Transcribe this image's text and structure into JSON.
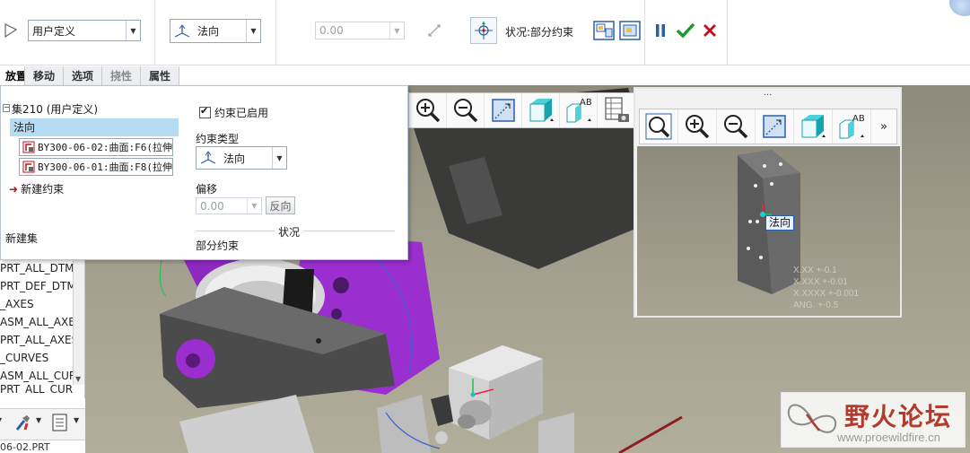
{
  "dashboard": {
    "constraint_set": "用户定义",
    "constraint_type": "法向",
    "offset_value": "0.00",
    "status_text": "状况:部分约束"
  },
  "tabs": [
    {
      "label": "放置"
    },
    {
      "label": "移动"
    },
    {
      "label": "选项"
    },
    {
      "label": "挠性"
    },
    {
      "label": "属性"
    }
  ],
  "placement_panel": {
    "set_header": "集210 (用户定义)",
    "selected_constraint": "法向",
    "references": [
      "BY300-06-02:曲面:F6(拉伸",
      "BY300-06-01:曲面:F8(拉伸"
    ],
    "new_constraint": "新建约束",
    "new_set": "新建集",
    "enabled_label": "约束已启用",
    "type_label": "约束类型",
    "type_value": "法向",
    "offset_label": "偏移",
    "offset_value": "0.00",
    "flip_button": "反向",
    "status_label": "状况",
    "status_value": "部分约束"
  },
  "model_tree": {
    "items": [
      "PRT_ALL_DTM_",
      "PRT_DEF_DTM_",
      "_AXES",
      "ASM_ALL_AXES",
      "PRT_ALL_AXES",
      "_CURVES",
      "ASM_ALL_CURV",
      "PRT_ALL_CUR"
    ],
    "file_name": "06-02.PRT"
  },
  "sub_window": {
    "title": "...",
    "tag_label": "法向",
    "readout": [
      "X.XX +-0.1",
      "X.XXX +-0.01",
      "X.XXXX +-0.001",
      "ANG. +-0.5"
    ],
    "more": "»"
  },
  "watermark": {
    "title": "野火论坛",
    "url": "www.proewildfire.cn"
  },
  "colors": {
    "accent_blue": "#2b5ea8",
    "ok_green": "#1a9a2a",
    "cancel_red": "#c0111b",
    "part_purple": "#9a2ecf"
  }
}
